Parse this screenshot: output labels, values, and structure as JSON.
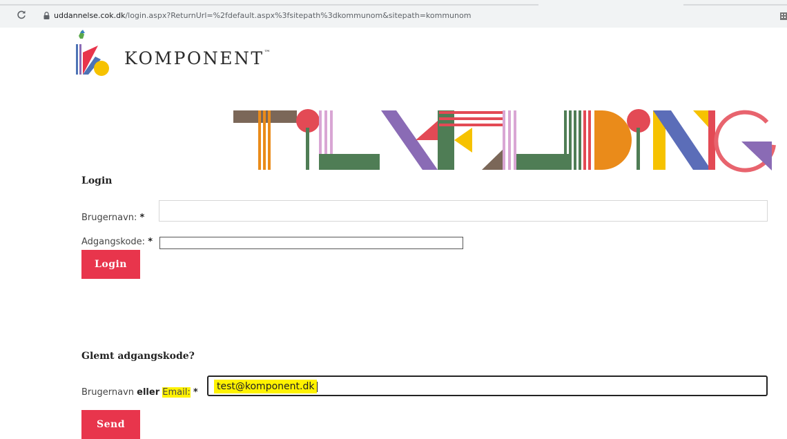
{
  "browser": {
    "url_host": "uddannelse.cok.dk",
    "url_path": "/login.aspx?ReturnUrl=%2fdefault.aspx%3fsitepath%3dkommunom&sitepath=kommunom"
  },
  "brand": {
    "name": "KOMPONENT",
    "trademark": "™",
    "banner_text": "TILMELDING"
  },
  "colors": {
    "primary_button": "#e8354c",
    "highlight": "#fff200"
  },
  "login": {
    "title": "Login",
    "username_label": "Brugernavn:",
    "username_value": "",
    "password_label": "Adgangskode:",
    "password_value": "",
    "required_marker": "*",
    "button": "Login"
  },
  "forgot": {
    "title": "Glemt adgangskode?",
    "label_prefix": "Brugernavn",
    "label_mid": "eller",
    "label_email": "Email:",
    "email_value": "test@komponent.dk",
    "button": "Send"
  }
}
